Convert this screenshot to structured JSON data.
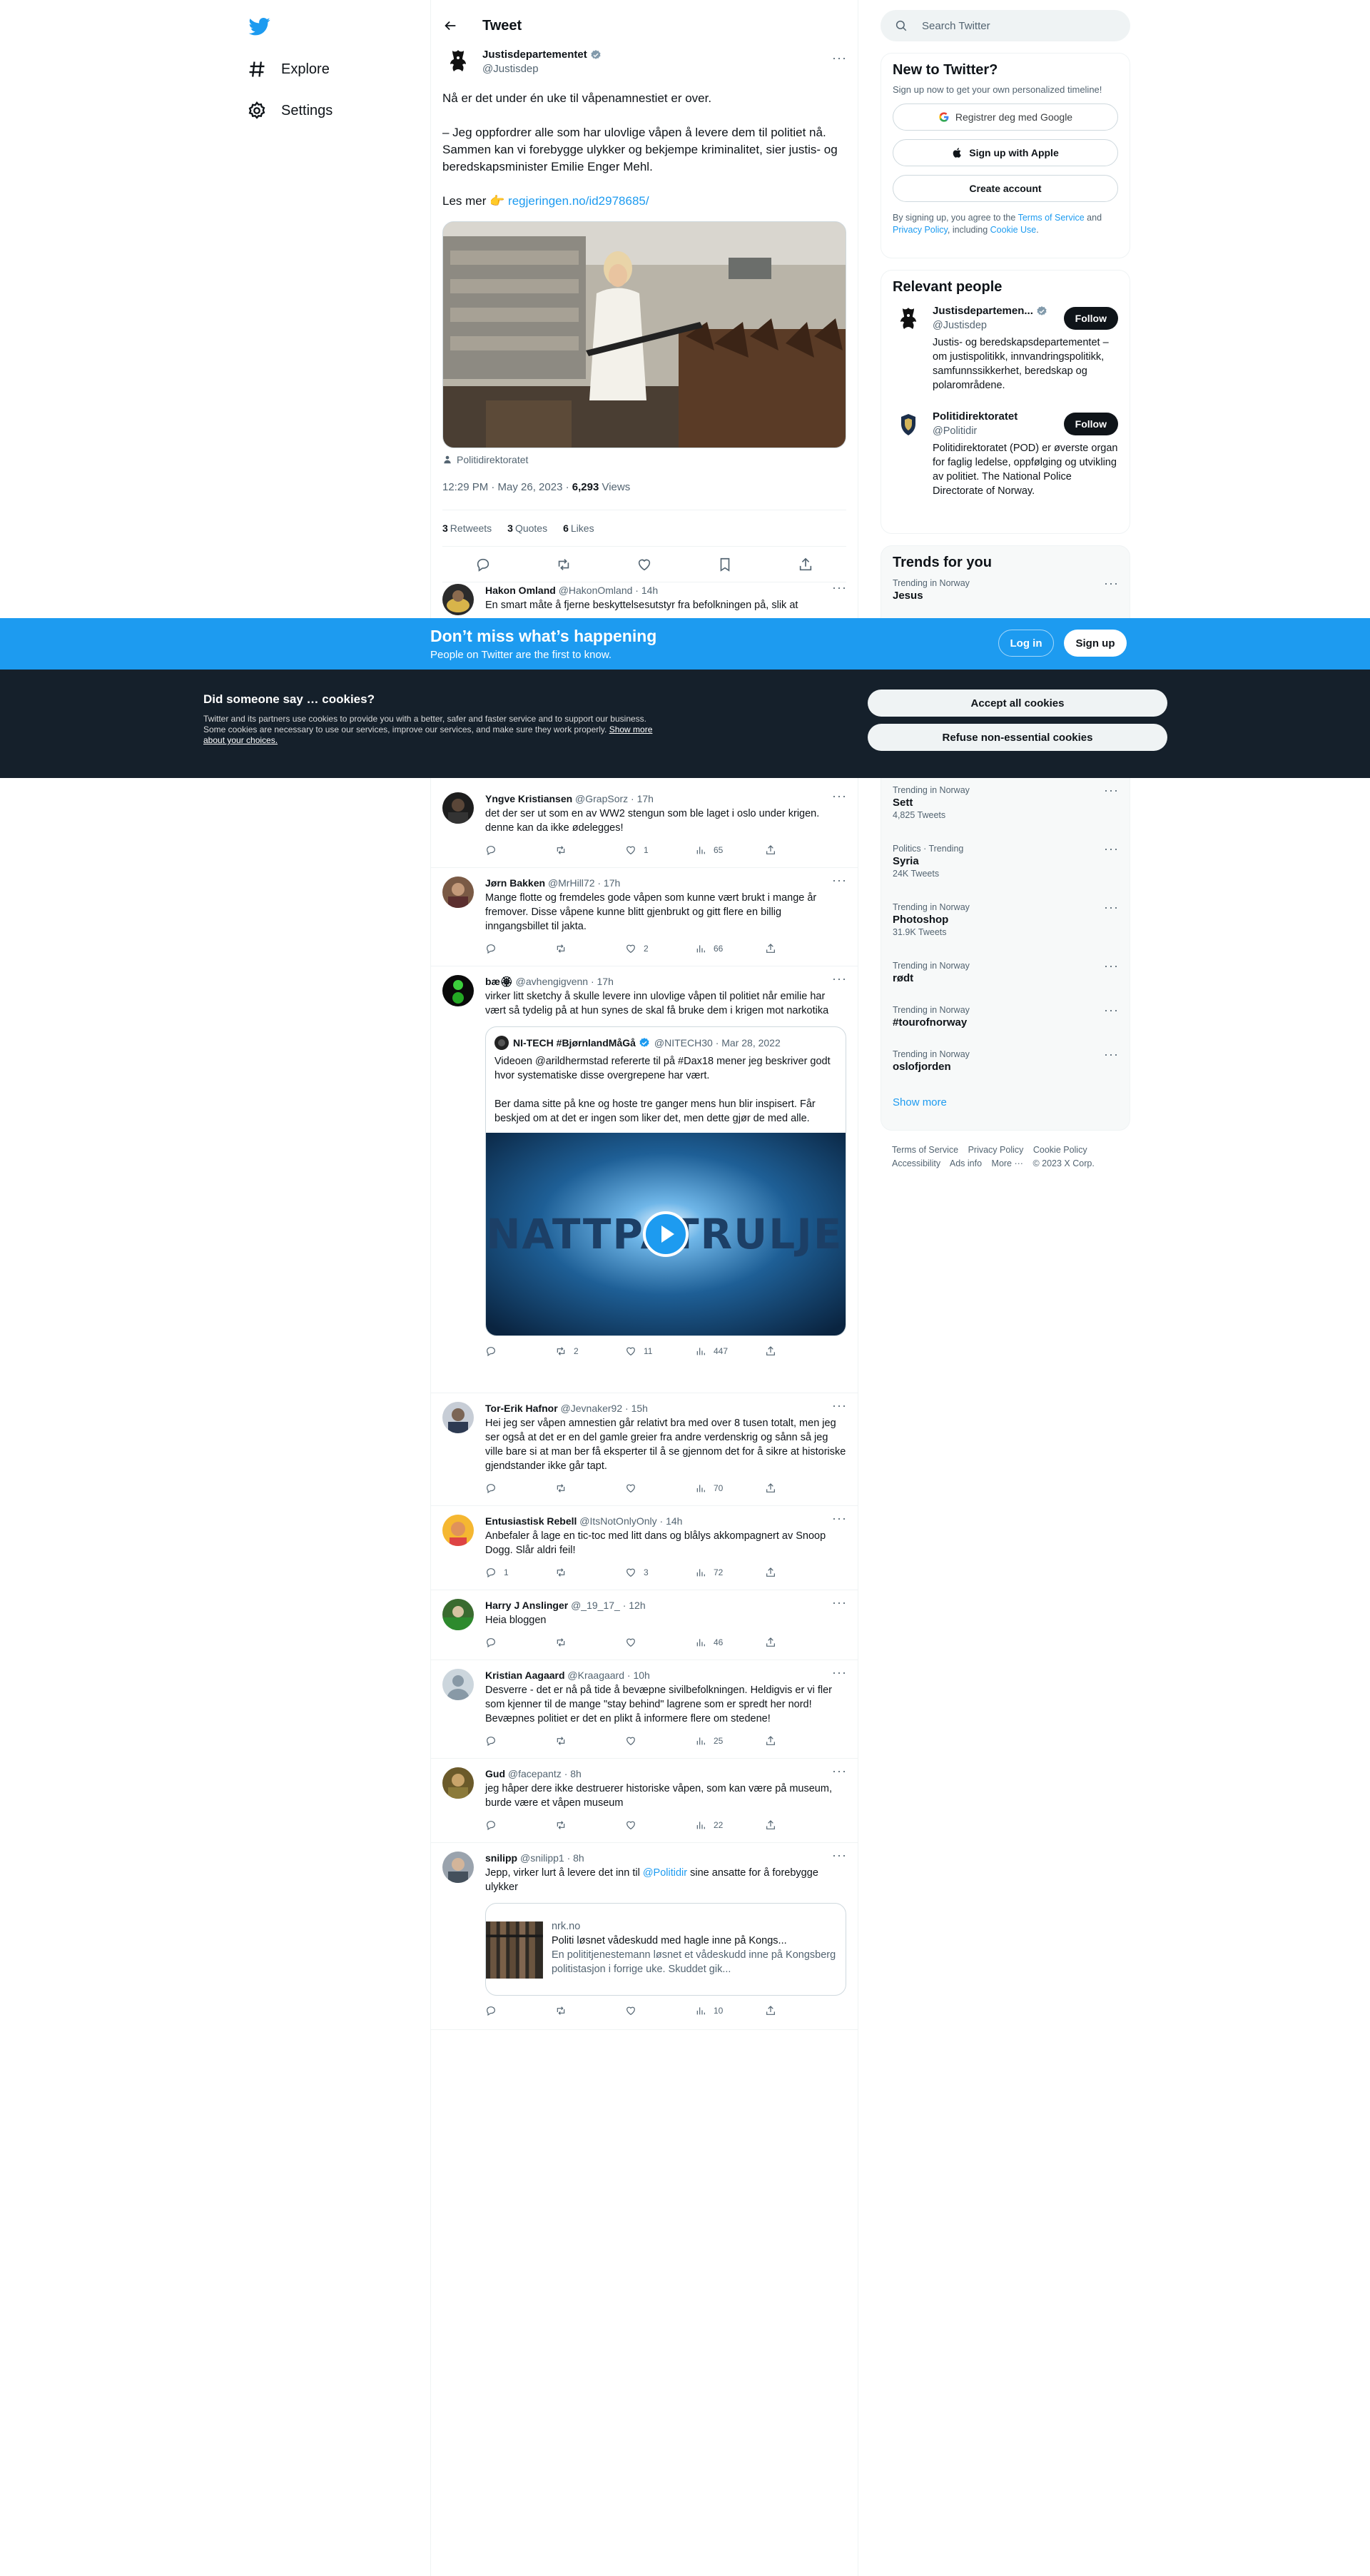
{
  "nav": {
    "explore": "Explore",
    "settings": "Settings"
  },
  "header": {
    "title": "Tweet"
  },
  "main_tweet": {
    "author_name": "Justisdepartementet",
    "author_handle": "@Justisdep",
    "text": "Nå er det under én uke til våpenamnestiet er over.\n\n– Jeg oppfordrer alle som har ulovlige våpen å levere dem til politiet nå. Sammen kan vi forebygge ulykker og bekjempe kriminalitet, sier justis- og beredskapsminister Emilie Enger Mehl.\n\nLes mer 👉 ",
    "link": "regjeringen.no/id2978685/",
    "media_caption": "Politidirektoratet",
    "time": "12:29 PM · May 26, 2023 · ",
    "views_count": "6,293",
    "views_label": " Views",
    "retweets_count": "3",
    "retweets_label": "Retweets",
    "quotes_count": "3",
    "quotes_label": "Quotes",
    "likes_count": "6",
    "likes_label": "Likes"
  },
  "replies": [
    {
      "name": "Hakon Omland",
      "meta": "@HakonOmland · 14h",
      "text": "En smart måte å fjerne beskyttelsesutstyr fra befolkningen på, slik at"
    },
    {
      "name": "Yngve Kristiansen",
      "meta": "@GrapSorz · 17h",
      "text": "det der ser ut som en av WW2 stengun som ble laget i oslo under krigen. denne kan da ikke ødelegges!",
      "replies": "",
      "retweets": "",
      "likes": "1",
      "views": "65"
    },
    {
      "name": "Jørn Bakken",
      "meta": "@MrHill72 · 17h",
      "text": "Mange flotte og fremdeles gode våpen som kunne vært brukt i mange år fremover. Disse våpene kunne blitt gjenbrukt og gitt flere en billig inngangsbillet til jakta.",
      "replies": "",
      "retweets": "",
      "likes": "2",
      "views": "66"
    },
    {
      "name": "bæ🏵",
      "meta": "@avhengigvenn · 17h",
      "text": "virker litt sketchy å skulle levere inn ulovlige våpen til politiet når emilie har vært så tydelig på at hun synes de skal få bruke dem i krigen mot narkotika",
      "replies": "",
      "retweets": "2",
      "likes": "11",
      "views": "447"
    },
    {
      "name": "Tor-Erik Hafnor",
      "meta": "@Jevnaker92 · 15h",
      "text": "Hei jeg ser våpen amnestien går relativt bra med over 8 tusen totalt,  men jeg ser også at det er en del gamle greier fra andre verdenskrig og  sånn så jeg ville bare si at man ber få eksperter til å  se gjennom det for å sikre at historiske gjendstander ikke går tapt.",
      "replies": "",
      "retweets": "",
      "likes": "",
      "views": "70"
    },
    {
      "name": "Entusiastisk Rebell",
      "meta": "@ItsNotOnlyOnly · 14h",
      "text": "Anbefaler å lage en tic-toc med litt dans og blålys akkompagnert av Snoop Dogg. Slår aldri feil!",
      "replies": "1",
      "retweets": "",
      "likes": "3",
      "views": "72"
    },
    {
      "name": "Harry J Anslinger",
      "meta": "@_19_17_ · 12h",
      "text": "Heia bloggen",
      "replies": "",
      "retweets": "",
      "likes": "",
      "views": "46"
    },
    {
      "name": "Kristian Aagaard",
      "meta": "@Kraagaard · 10h",
      "text": "Desverre - det er nå på tide å bevæpne sivilbefolkningen. Heldigvis er vi fler som kjenner til de mange \"stay behind\" lagrene som er spredt her nord! Bevæpnes politiet er det en plikt å informere flere om stedene!",
      "replies": "",
      "retweets": "",
      "likes": "",
      "views": "25"
    },
    {
      "name": "Gud",
      "meta": "@facepantz · 8h",
      "text": "jeg håper dere ikke destruerer historiske våpen, som kan være på museum, burde være et våpen museum",
      "replies": "",
      "retweets": "",
      "likes": "",
      "views": "22"
    },
    {
      "name": "snilipp",
      "meta": "@snilipp1 · 8h",
      "text_before": "Jepp, virker lurt å levere det inn til ",
      "mention": "@Politidir",
      "text_after": " sine ansatte for å forebygge ulykker",
      "replies": "",
      "retweets": "",
      "likes": "",
      "views": "10"
    }
  ],
  "quote": {
    "name": "NI-TECH #BjørnlandMåGå",
    "meta": "@NITECH30 · Mar 28, 2022",
    "text": "Videoen @arildhermstad refererte til på #Dax18 mener jeg beskriver godt hvor systematiske disse overgrepene har vært.\n\nBer dama sitte på kne og hoste tre ganger mens hun blir inspisert. Får beskjed om at det er ingen som liker det, men dette gjør de med alle.",
    "video_title": "NATTPATRULJEN"
  },
  "link_card": {
    "domain": "nrk.no",
    "title": "Politi løsnet vådeskudd med hagle inne på Kongs...",
    "desc": "En polititjenestemann løsnet et vådeskudd inne på Kongsberg politistasjon i forrige uke. Skuddet gik..."
  },
  "search": {
    "placeholder": "Search Twitter"
  },
  "new_to_twitter": {
    "title": "New to Twitter?",
    "sub": "Sign up now to get your own personalized timeline!",
    "google": "Registrer deg med Google",
    "apple": "Sign up with Apple",
    "create": "Create account",
    "terms_pre": "By signing up, you agree to the ",
    "terms_link": "Terms of Service",
    "terms_mid": " and ",
    "privacy_link": "Privacy Policy",
    "terms_mid2": ", including ",
    "cookie_link": "Cookie Use",
    "terms_end": "."
  },
  "relevant": {
    "title": "Relevant people",
    "people": [
      {
        "name": "Justisdepartemen...",
        "handle": "@Justisdep",
        "desc": "Justis- og beredskapsdepartementet – om justispolitikk, innvandringspolitikk, samfunnssikkerhet, beredskap og polarområdene.",
        "follow": "Follow"
      },
      {
        "name": "Politidirektoratet",
        "handle": "@Politidir",
        "desc": "Politidirektoratet (POD) er øverste organ for faglig ledelse, oppfølging og utvikling av politiet. The National Police Directorate of Norway.",
        "follow": "Follow"
      }
    ]
  },
  "trends": {
    "title": "Trends for you",
    "first": {
      "context": "Trending in Norway",
      "name": "Jesus"
    },
    "items": [
      {
        "context": "Trending in Norway",
        "name": "Sett",
        "count": "4,825 Tweets"
      },
      {
        "context": "Politics · Trending",
        "name": "Syria",
        "count": "24K Tweets"
      },
      {
        "context": "Trending in Norway",
        "name": "Photoshop",
        "count": "31.9K Tweets"
      },
      {
        "context": "Trending in Norway",
        "name": "rødt",
        "count": ""
      },
      {
        "context": "Trending in Norway",
        "name": "#tourofnorway",
        "count": ""
      },
      {
        "context": "Trending in Norway",
        "name": "oslofjorden",
        "count": ""
      }
    ],
    "show_more": "Show more"
  },
  "footer": {
    "links": [
      "Terms of Service",
      "Privacy Policy",
      "Cookie Policy",
      "Accessibility",
      "Ads info",
      "More ···",
      "© 2023 X Corp."
    ]
  },
  "signup_bar": {
    "title": "Don’t miss what’s happening",
    "sub": "People on Twitter are the first to know.",
    "login": "Log in",
    "signup": "Sign up"
  },
  "cookies": {
    "title": "Did someone say … cookies?",
    "desc": "Twitter and its partners use cookies to provide you with a better, safer and faster service and to support our business. Some cookies are necessary to use our services, improve our services, and make sure they work properly. ",
    "link": "Show more about your choices.",
    "accept": "Accept all cookies",
    "refuse": "Refuse non-essential cookies"
  },
  "colors": {
    "accent": "#1d9bf0",
    "text": "#0f1419",
    "muted": "#536471",
    "cookie_bg": "#15202b"
  }
}
